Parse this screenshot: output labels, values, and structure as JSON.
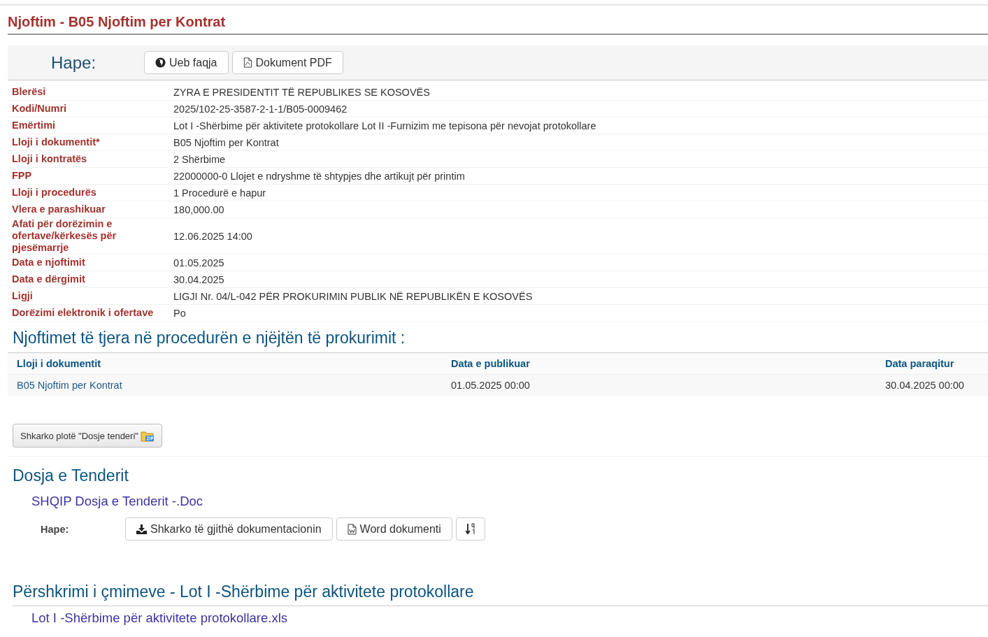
{
  "page_title": "Njoftim - B05 Njoftim per Kontrat",
  "open_bar": {
    "label": "Hape:",
    "buttons": [
      {
        "kind": "web",
        "label": "Ueb faqja"
      },
      {
        "kind": "pdf",
        "label": "Dokument PDF"
      }
    ]
  },
  "details": [
    {
      "label": "Blerësi",
      "value": "ZYRA E PRESIDENTIT TË REPUBLIKES SE KOSOVËS"
    },
    {
      "label": "Kodi/Numri",
      "value": "2025/102-25-3587-2-1-1/B05-0009462"
    },
    {
      "label": "Emërtimi",
      "value": "Lot I -Shërbime për aktivitete protokollare Lot II -Furnizim me tepisona për nevojat protokollare"
    },
    {
      "label": "Lloji i dokumentit*",
      "value": "B05 Njoftim per Kontrat"
    },
    {
      "label": "Lloji i kontratës",
      "value": "2 Shërbime"
    },
    {
      "label": "FPP",
      "value": "22000000-0 Llojet e ndryshme të shtypjes dhe artikujt për printim"
    },
    {
      "label": "Lloji i procedurës",
      "value": "1 Procedurë e hapur"
    },
    {
      "label": "Vlera e parashikuar",
      "value": "180,000.00"
    },
    {
      "label": "Afati për dorëzimin e ofertave/kërkesës për pjesëmarrje",
      "value": "12.06.2025 14:00"
    },
    {
      "label": "Data e njoftimit",
      "value": "01.05.2025"
    },
    {
      "label": "Data e dërgimit",
      "value": "30.04.2025"
    },
    {
      "label": "Ligji",
      "value": "LIGJI Nr. 04/L-042 PËR PROKURIMIN PUBLIK NË REPUBLIKËN E KOSOVËS"
    },
    {
      "label": "Dorëzimi elektronik i ofertave",
      "value": "Po"
    }
  ],
  "other_notices": {
    "title": "Njoftimet të tjera në procedurën e njëjtën të prokurimit :",
    "columns": [
      "Lloji i dokumentit",
      "Data e publikuar",
      "Data paraqitur"
    ],
    "rows": [
      {
        "document_type": "B05 Njoftim per Kontrat",
        "published": "01.05.2025 00:00",
        "submitted": "30.04.2025 00:00"
      }
    ]
  },
  "download_all_button": "Shkarko plotë \"Dosje tenderi\"",
  "tender_file": {
    "title": "Dosja e Tenderit",
    "document_link": "SHQIP Dosja e Tenderit -.Doc",
    "open_label": "Hape:",
    "buttons": [
      {
        "kind": "download",
        "label": "Shkarko të gjithë dokumentacionin"
      },
      {
        "kind": "word",
        "label": "Word dokumenti"
      },
      {
        "kind": "sort"
      }
    ]
  },
  "price_description": {
    "title": "Përshkrimi i çmimeve - Lot I -Shërbime për aktivitete protokollare",
    "file_link": "Lot I -Shërbime për aktivitete protokollare.xls"
  }
}
